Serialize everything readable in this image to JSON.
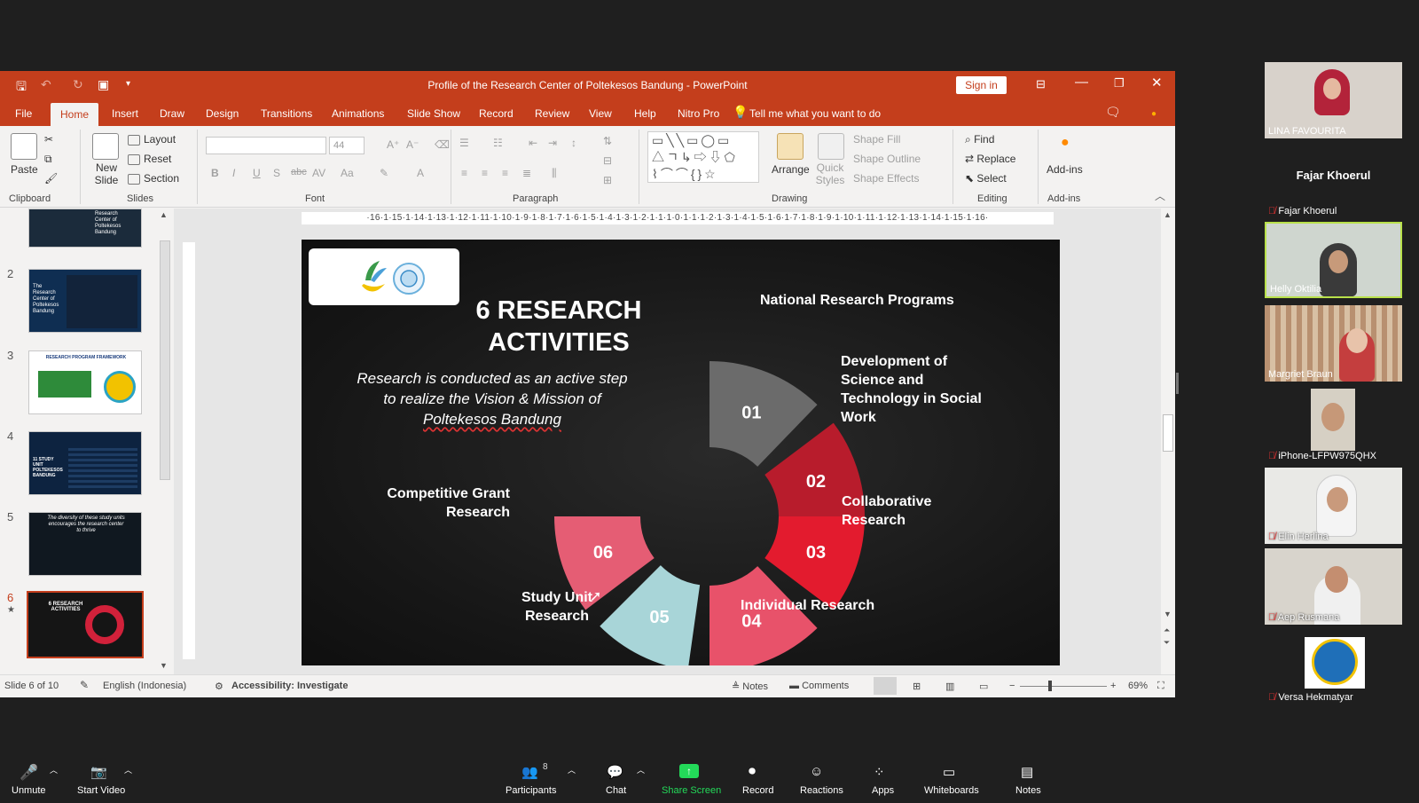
{
  "window": {
    "title": "Profile of the Research Center of Poltekesos Bandung  -  PowerPoint",
    "sign_in": "Sign in"
  },
  "tabs": [
    "File",
    "Home",
    "Insert",
    "Draw",
    "Design",
    "Transitions",
    "Animations",
    "Slide Show",
    "Record",
    "Review",
    "View",
    "Help",
    "Nitro Pro"
  ],
  "tell_me": "Tell me what you want to do",
  "ribbon": {
    "clipboard": {
      "paste": "Paste",
      "label": "Clipboard"
    },
    "slides": {
      "new_slide": "New Slide",
      "layout": "Layout",
      "reset": "Reset",
      "section": "Section",
      "label": "Slides"
    },
    "font": {
      "size": "44",
      "label": "Font"
    },
    "paragraph": {
      "label": "Paragraph"
    },
    "drawing": {
      "arrange": "Arrange",
      "quick_styles": "Quick Styles",
      "shape_fill": "Shape Fill",
      "shape_outline": "Shape Outline",
      "shape_effects": "Shape Effects",
      "label": "Drawing"
    },
    "editing": {
      "find": "Find",
      "replace": "Replace",
      "select": "Select",
      "label": "Editing"
    },
    "addins": {
      "addins": "Add-ins",
      "label": "Add-ins"
    }
  },
  "ruler": "·16·1·15·1·14·1·13·1·12·1·11·1·10·1·9·1·8·1·7·1·6·1·5·1·4·1·3·1·2·1·1·1·0·1·1·1·2·1·3·1·4·1·5·1·6·1·7·1·8·1·9·1·10·1·11·1·12·1·13·1·14·1·15·1·16·",
  "thumbnails": [
    {
      "num": "2",
      "text": "The Research Center of Poltekesos Bandung"
    },
    {
      "num": "3",
      "text": "RESEARCH PROGRAM FRAMEWORK"
    },
    {
      "num": "4",
      "text": "11 STUDY UNIT POLTEKESOS BANDUNG"
    },
    {
      "num": "5",
      "text": "The diversity of these study units encourages the research center to thrive"
    },
    {
      "num": "6",
      "text": "6 RESEARCH ACTIVITIES"
    }
  ],
  "thumb_top_text": "Research Center of Poltekesos Bandung",
  "slide": {
    "title": "6 RESEARCH ACTIVITIES",
    "subtitle_line1": "Research is conducted as an active step",
    "subtitle_line2": "to realize the Vision & Mission of",
    "subtitle_line3": "Poltekesos Bandung",
    "items": [
      {
        "num": "01",
        "label": "National Research Programs",
        "color": "#6b6b6b"
      },
      {
        "num": "02",
        "label": "Development of Science and Technology in Social Work",
        "color": "#b81c2c"
      },
      {
        "num": "03",
        "label": "Collaborative Research",
        "color": "#e31b2e"
      },
      {
        "num": "04",
        "label": "Individual Research",
        "color": "#e8526a"
      },
      {
        "num": "05",
        "label": "Study Unit Research",
        "color": "#a8d5d8"
      },
      {
        "num": "06",
        "label": "Competitive Grant Research",
        "color": "#e55d74"
      }
    ]
  },
  "status": {
    "slide_of": "Slide 6 of 10",
    "language": "English (Indonesia)",
    "accessibility": "Accessibility: Investigate",
    "notes": "Notes",
    "comments": "Comments",
    "zoom": "69%"
  },
  "participants": [
    {
      "name": "LINA FAVOURITA",
      "muted": false
    },
    {
      "name": "Fajar Khoerul",
      "display": "Fajar Khoerul",
      "muted": true
    },
    {
      "name": "Helly Oktilia",
      "muted": false,
      "active": true
    },
    {
      "name": "Margriet Braun",
      "muted": false
    },
    {
      "name": "iPhone-LFPW975QHX",
      "muted": true
    },
    {
      "name": "Elin Herlina",
      "muted": true
    },
    {
      "name": "Aep Rusmana",
      "muted": true
    },
    {
      "name": "Versa Hekmatyar",
      "muted": true
    }
  ],
  "toolbar": {
    "unmute": "Unmute",
    "start_video": "Start Video",
    "participants": "Participants",
    "participants_count": "8",
    "chat": "Chat",
    "share": "Share Screen",
    "record": "Record",
    "reactions": "Reactions",
    "apps": "Apps",
    "whiteboards": "Whiteboards",
    "notes": "Notes"
  }
}
